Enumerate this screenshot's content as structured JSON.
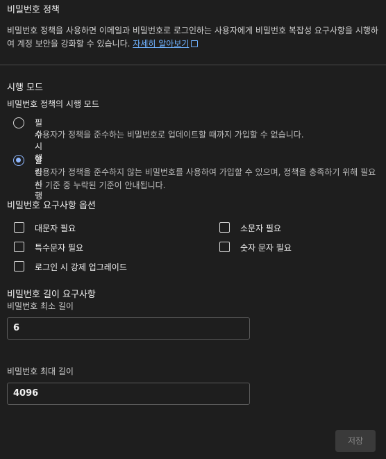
{
  "header": {
    "title": "비밀번호 정책",
    "description": "비밀번호 정책을 사용하면 이메일과 비밀번호로 로그인하는 사용자에게 비밀번호 복잡성 요구사항을 시행하여 계정 보안을 강화할 수 있습니다.",
    "learn_more": "자세히 알아보기"
  },
  "mode": {
    "heading": "시행 모드",
    "subheading": "비밀번호 정책의 시행 모드",
    "options": [
      {
        "label": "필수 시행",
        "description": "사용자가 정책을 준수하는 비밀번호로 업데이트할 때까지 가입할 수 없습니다.",
        "checked": false
      },
      {
        "label": "알림 시행",
        "description": "사용자가 정책을 준수하지 않는 비밀번호를 사용하여 가입할 수 있으며, 정책을 충족하기 위해 필요한 기준 중 누락된 기준이 안내됩니다.",
        "checked": true
      }
    ]
  },
  "requirements": {
    "heading": "비밀번호 요구사항 옵션",
    "items": [
      {
        "label": "대문자 필요",
        "checked": false
      },
      {
        "label": "소문자 필요",
        "checked": false
      },
      {
        "label": "특수문자 필요",
        "checked": false
      },
      {
        "label": "숫자 문자 필요",
        "checked": false
      },
      {
        "label": "로그인 시 강제 업그레이드",
        "checked": false
      }
    ]
  },
  "length": {
    "heading": "비밀번호 길이 요구사항",
    "min_label": "비밀번호 최소 길이",
    "min_value": "6",
    "max_label": "비밀번호 최대 길이",
    "max_value": "4096"
  },
  "actions": {
    "save_label": "저장"
  }
}
